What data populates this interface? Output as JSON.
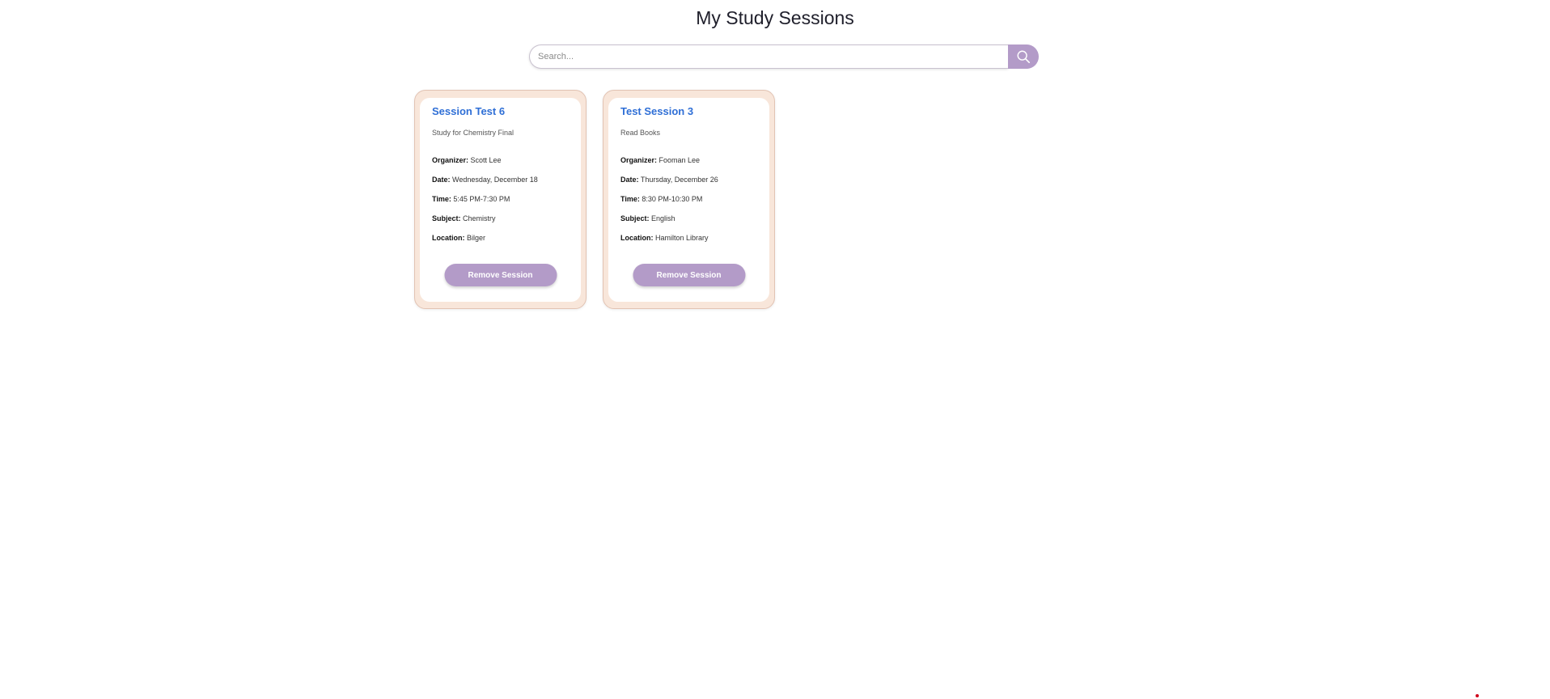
{
  "page": {
    "title": "My Study Sessions"
  },
  "search": {
    "placeholder": "Search...",
    "value": "",
    "button_icon": "search-icon"
  },
  "theme": {
    "accent": "#b39bc8",
    "card_border": "#f8e6da",
    "title_link": "#2f6fd6"
  },
  "sessions": [
    {
      "title": "Session Test 6",
      "description": "Study for Chemistry Final",
      "organizer_label": "Organizer:",
      "organizer": "Scott Lee",
      "date_label": "Date:",
      "date": "Wednesday, December 18",
      "time_label": "Time:",
      "time": "5:45 PM-7:30 PM",
      "subject_label": "Subject:",
      "subject": "Chemistry",
      "location_label": "Location:",
      "location": "Bilger",
      "remove_label": "Remove Session"
    },
    {
      "title": "Test Session 3",
      "description": "Read Books",
      "organizer_label": "Organizer:",
      "organizer": "Fooman Lee",
      "date_label": "Date:",
      "date": "Thursday, December 26",
      "time_label": "Time:",
      "time": "8:30 PM-10:30 PM",
      "subject_label": "Subject:",
      "subject": "English",
      "location_label": "Location:",
      "location": "Hamilton Library",
      "remove_label": "Remove Session"
    }
  ]
}
